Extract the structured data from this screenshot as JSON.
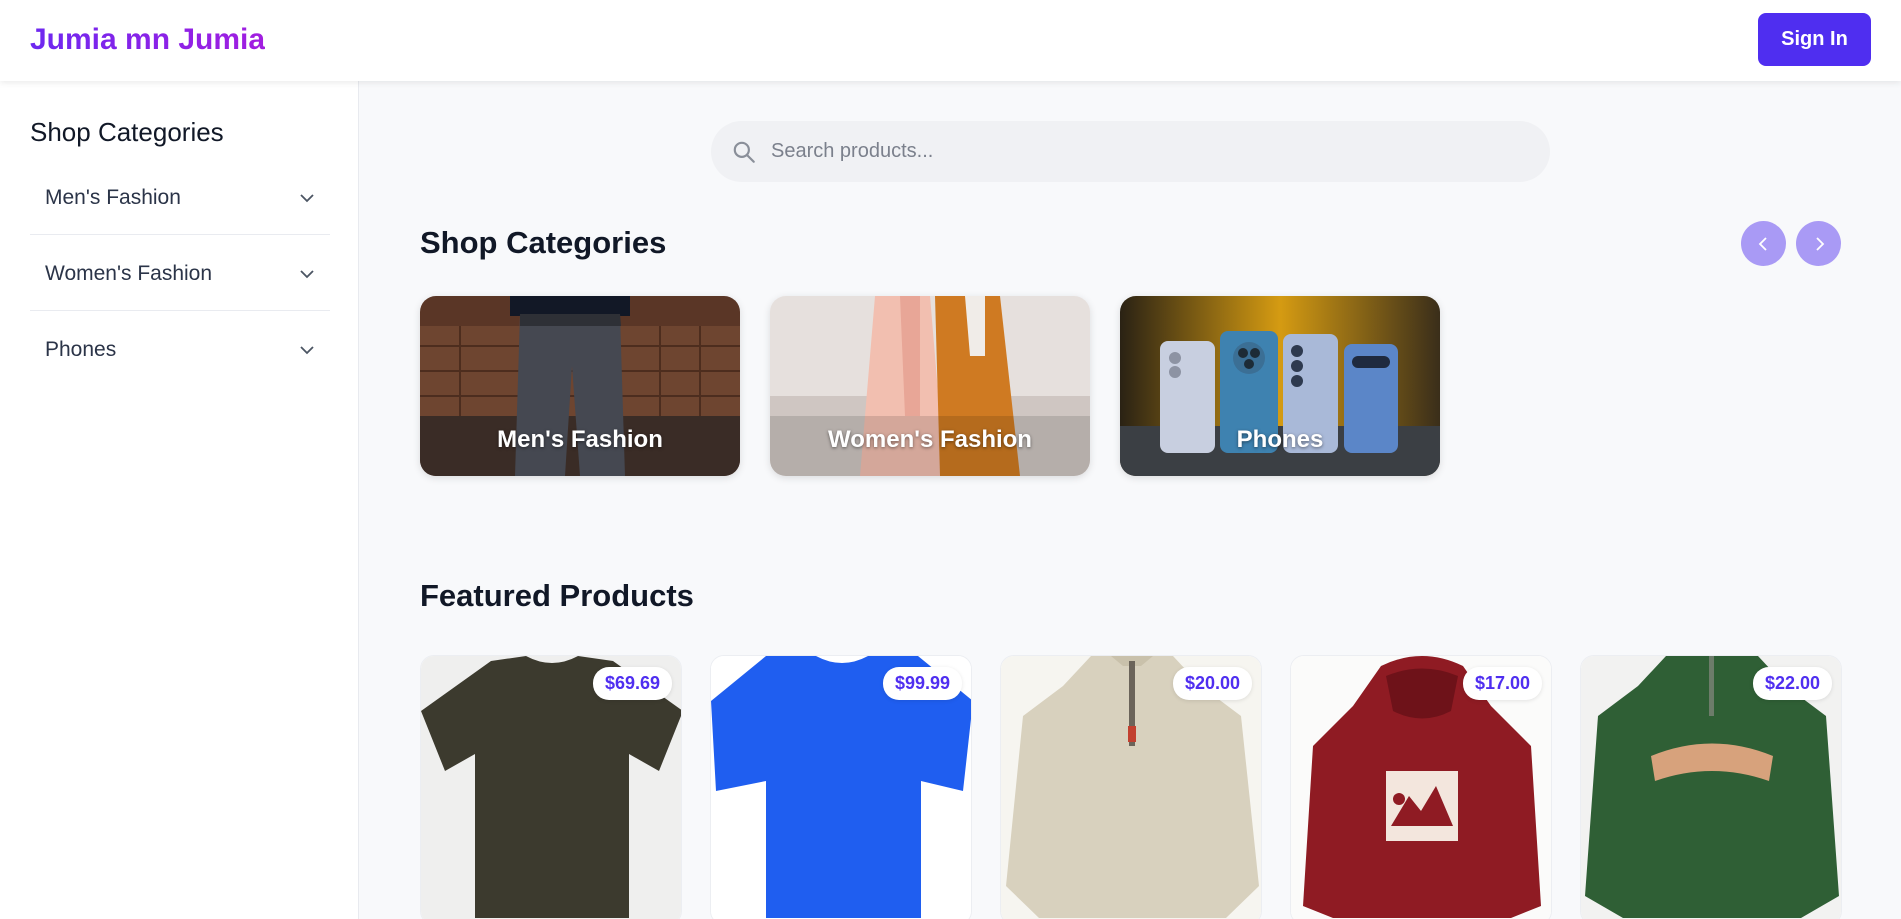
{
  "header": {
    "brand": "Jumia mn Jumia",
    "signin_label": "Sign In"
  },
  "sidebar": {
    "title": "Shop Categories",
    "items": [
      {
        "label": "Men's Fashion"
      },
      {
        "label": "Women's Fashion"
      },
      {
        "label": "Phones"
      }
    ]
  },
  "search": {
    "placeholder": "Search products..."
  },
  "categories_section": {
    "title": "Shop Categories",
    "cards": [
      {
        "label": "Men's Fashion"
      },
      {
        "label": "Women's Fashion"
      },
      {
        "label": "Phones"
      }
    ]
  },
  "featured": {
    "title": "Featured Products",
    "products": [
      {
        "price": "$69.69",
        "image": "olive t-shirt"
      },
      {
        "price": "$99.99",
        "image": "blue t-shirt"
      },
      {
        "price": "$20.00",
        "image": "beige quarter-zip pullover"
      },
      {
        "price": "$17.00",
        "image": "red mountain hoodie"
      },
      {
        "price": "$22.00",
        "image": "green california pullover"
      }
    ]
  },
  "colors": {
    "accent": "#4f2ef0",
    "brand_gradient_start": "#6d28f0",
    "brand_gradient_end": "#a21ee0",
    "carousel_button": "#a99af5"
  }
}
